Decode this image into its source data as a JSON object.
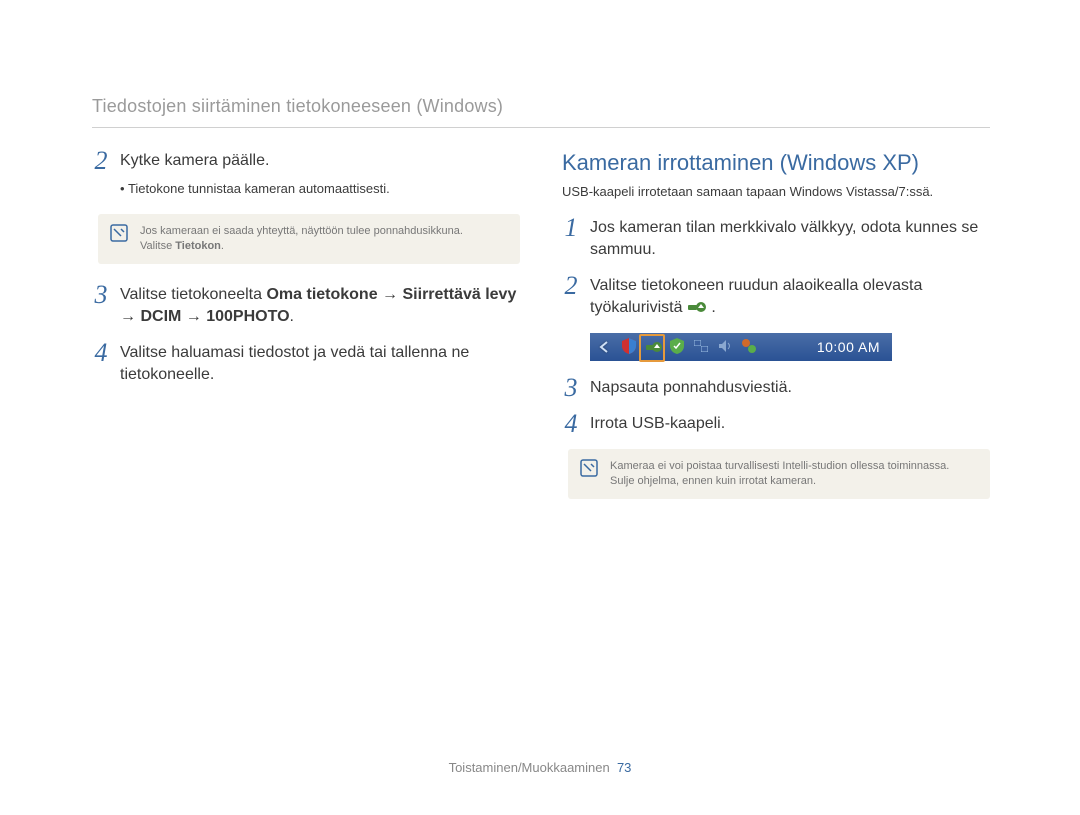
{
  "header": {
    "title": "Tiedostojen siirtäminen tietokoneeseen (Windows)"
  },
  "left": {
    "step2": {
      "num": "2",
      "text": "Kytke kamera päälle.",
      "bullet": "Tietokone tunnistaa kameran automaattisesti."
    },
    "tip": {
      "line1": "Jos kameraan ei saada yhteyttä, näyttöön tulee ponnahdusikkuna.",
      "line2_a": "Valitse ",
      "line2_b": "Tietokon",
      "line2_c": "."
    },
    "step3": {
      "num": "3",
      "pre": "Valitse tietokoneelta ",
      "b1": "Oma tietokone",
      "arr1": " → ",
      "b2": "Siirrettävä levy",
      "arr2": " → ",
      "b3": "DCIM",
      "arr3": " → ",
      "b4": "100PHOTO",
      "post": "."
    },
    "step4": {
      "num": "4",
      "text": "Valitse haluamasi tiedostot ja vedä tai tallenna ne tietokoneelle."
    }
  },
  "right": {
    "heading": "Kameran irrottaminen (Windows XP)",
    "sub": "USB-kaapeli irrotetaan samaan tapaan Windows Vistassa/7:ssä.",
    "step1": {
      "num": "1",
      "text": "Jos kameran tilan merkkivalo välkkyy, odota kunnes se sammuu."
    },
    "step2": {
      "num": "2",
      "text_a": "Valitse tietokoneen ruudun alaoikealla olevasta työkalurivistä ",
      "text_b": "."
    },
    "tray": {
      "clock": "10:00 AM"
    },
    "step3": {
      "num": "3",
      "text": "Napsauta ponnahdusviestiä."
    },
    "step4": {
      "num": "4",
      "text": "Irrota USB-kaapeli."
    },
    "tip": {
      "line1": "Kameraa ei voi poistaa turvallisesti Intelli-studion ollessa toiminnassa.",
      "line2": "Sulje ohjelma, ennen kuin irrotat kameran."
    }
  },
  "footer": {
    "text": "Toistaminen/Muokkaaminen",
    "page": "73"
  }
}
